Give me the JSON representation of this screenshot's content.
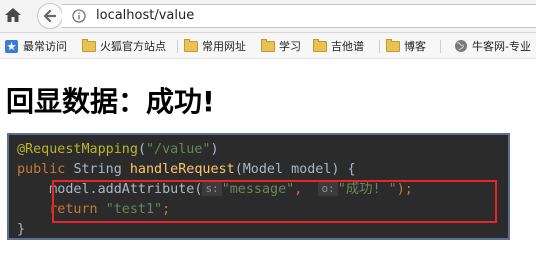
{
  "browser": {
    "url": "localhost/value",
    "url_host": "localhost",
    "url_path": "/value"
  },
  "bookmarks": {
    "items": [
      {
        "label": "最常访问",
        "icon": "bookmark-star-icon"
      },
      {
        "label": "火狐官方站点",
        "icon": "folder-icon"
      },
      {
        "label": "常用网址",
        "icon": "folder-icon"
      },
      {
        "label": "学习",
        "icon": "folder-icon"
      },
      {
        "label": "吉他谱",
        "icon": "folder-icon"
      },
      {
        "label": "博客",
        "icon": "folder-icon"
      },
      {
        "label": "牛客网-专业",
        "icon": "globe-icon"
      }
    ]
  },
  "page": {
    "heading": "回显数据：成功!"
  },
  "code": {
    "line1": {
      "annotation": "@RequestMapping",
      "open": "(",
      "arg": "\"/value\"",
      "close": ")"
    },
    "line2": {
      "kw_public": "public",
      "type": "String",
      "method": "handleRequest",
      "params": "(Model model) {"
    },
    "line3": {
      "target": "model.addAttribute(",
      "hint1": "s:",
      "arg1": "\"message\"",
      "comma": ",",
      "hint2": "o:",
      "arg2": "\"成功! \"",
      "end": ");"
    },
    "line4": {
      "kw_return": "return",
      "value": "\"test1\"",
      "end": ";"
    },
    "line5": {
      "brace": "}"
    }
  },
  "colors": {
    "code_bg": "#2b2b2b",
    "code_border": "#5b6f94",
    "highlight_box": "#e8262a",
    "annotation": "#bbb529",
    "string": "#6a8759",
    "keyword": "#cc7832",
    "method": "#ffc66d"
  }
}
